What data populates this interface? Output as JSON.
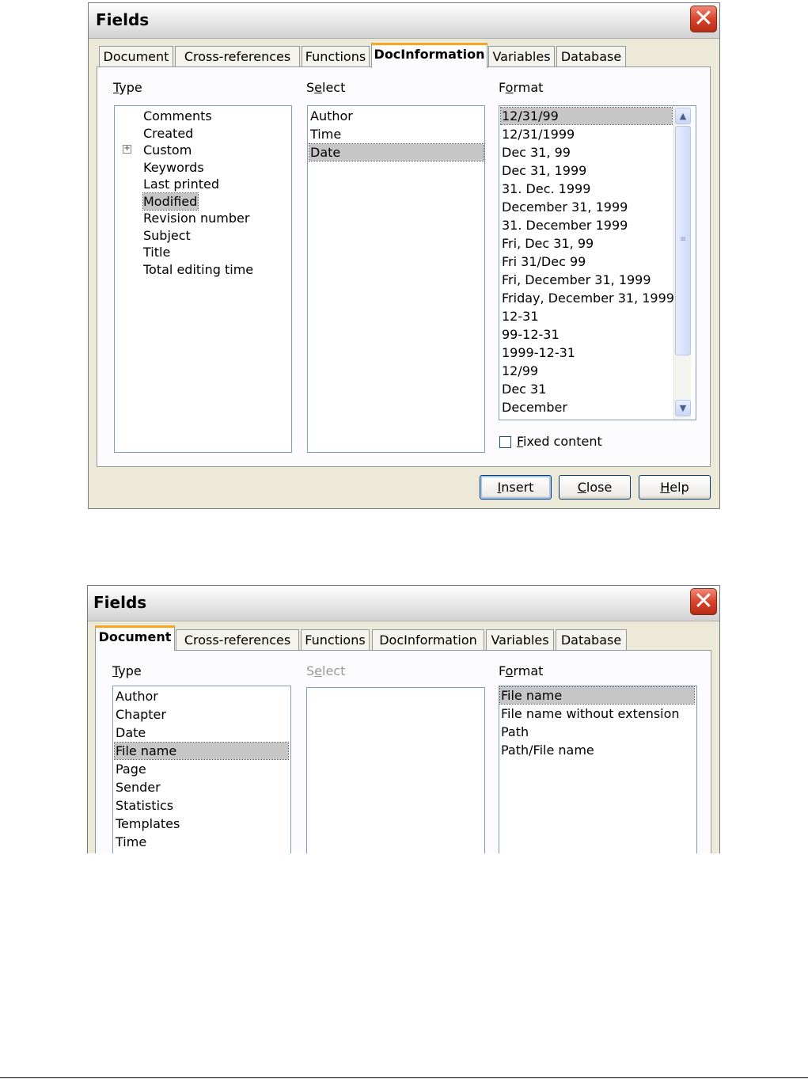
{
  "dialog1": {
    "title": "Fields",
    "tabs": [
      "Document",
      "Cross-references",
      "Functions",
      "DocInformation",
      "Variables",
      "Database"
    ],
    "type_label_u": "T",
    "type_label_rest": "ype",
    "select_label_pre": "S",
    "select_label_u": "e",
    "select_label_rest": "lect",
    "format_label_pre": "F",
    "format_label_u": "o",
    "format_label_rest": "rmat",
    "type_items": [
      "Comments",
      "Created",
      "Custom",
      "Keywords",
      "Last printed",
      "Modified",
      "Revision number",
      "Subject",
      "Title",
      "Total editing time"
    ],
    "type_expander": "+",
    "select_items": [
      "Author",
      "Time",
      "Date"
    ],
    "format_items": [
      "12/31/99",
      "12/31/1999",
      "Dec 31, 99",
      "Dec 31, 1999",
      "31. Dec. 1999",
      "December 31, 1999",
      "31. December 1999",
      "Fri, Dec 31, 99",
      "Fri 31/Dec 99",
      "Fri, December 31, 1999",
      "Friday, December 31, 1999",
      "12-31",
      "99-12-31",
      "1999-12-31",
      "12/99",
      "Dec 31",
      "December"
    ],
    "fixed_content_u": "F",
    "fixed_content_rest": "ixed content",
    "buttons": {
      "insert_u": "I",
      "insert_rest": "nsert",
      "close_u": "C",
      "close_rest": "lose",
      "help_u": "H",
      "help_rest": "elp"
    }
  },
  "dialog2": {
    "title": "Fields",
    "tabs": [
      "Document",
      "Cross-references",
      "Functions",
      "DocInformation",
      "Variables",
      "Database"
    ],
    "type_label_u": "T",
    "type_label_rest": "ype",
    "select_label_pre": "S",
    "select_label_u": "e",
    "select_label_rest": "lect",
    "format_label_pre": "F",
    "format_label_u": "o",
    "format_label_rest": "rmat",
    "type_items": [
      "Author",
      "Chapter",
      "Date",
      "File name",
      "Page",
      "Sender",
      "Statistics",
      "Templates",
      "Time"
    ],
    "format_items": [
      "File name",
      "File name without extension",
      "Path",
      "Path/File name"
    ]
  },
  "icons": {
    "close": "close-x-icon",
    "expander": "plus-expander-icon",
    "scroll_up": "up-arrow-icon",
    "scroll_down": "down-arrow-icon",
    "scroll_grip": "grip-icon"
  }
}
